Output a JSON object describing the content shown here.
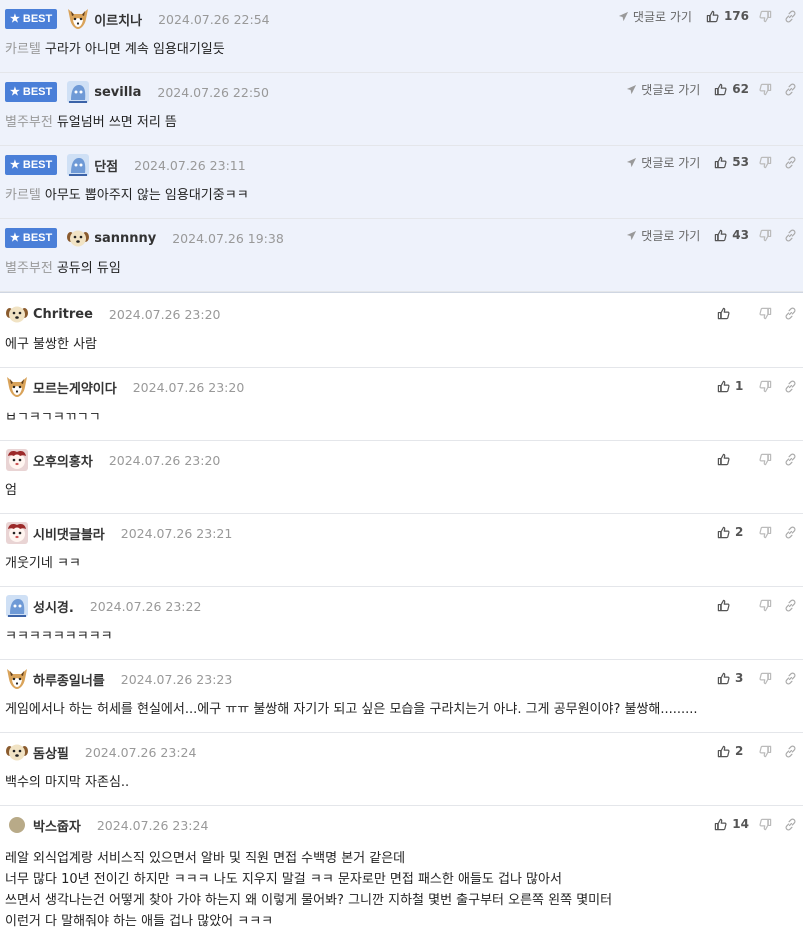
{
  "best_label": "BEST",
  "goto_label": "댓글로 가기",
  "best_comments": [
    {
      "nick": "이르치나",
      "date": "2024.07.26 22:54",
      "tag": "카르텔",
      "text": "구라가 아니면 계속 임용대기일듯",
      "likes": "176",
      "avatar": "fox"
    },
    {
      "nick": "sevilla",
      "date": "2024.07.26 22:50",
      "tag": "별주부전",
      "text": "듀얼넘버 쓰면 저리 뜸",
      "likes": "62",
      "avatar": "blue"
    },
    {
      "nick": "단점",
      "date": "2024.07.26 23:11",
      "tag": "카르텔",
      "text": "아무도 뽑아주지 않는 임용대기중ㅋㅋ",
      "likes": "53",
      "avatar": "blue"
    },
    {
      "nick": "sannnny",
      "date": "2024.07.26 19:38",
      "tag": "별주부전",
      "text": "공듀의 듀임",
      "likes": "43",
      "avatar": "dog"
    }
  ],
  "comments": [
    {
      "nick": "Chritree",
      "date": "2024.07.26 23:20",
      "text": "에구 불쌍한 사람",
      "likes": "",
      "avatar": "dog"
    },
    {
      "nick": "모르는게약이다",
      "date": "2024.07.26 23:20",
      "text": "ㅂㄱㅋㄱㅋㄲㄱㄱ",
      "likes": "1",
      "avatar": "fox"
    },
    {
      "nick": "오후의홍차",
      "date": "2024.07.26 23:20",
      "text": "엄",
      "likes": "",
      "avatar": "red"
    },
    {
      "nick": "시비댓글블라",
      "date": "2024.07.26 23:21",
      "text": "개웃기네 ㅋㅋ",
      "likes": "2",
      "avatar": "red"
    },
    {
      "nick": "성시경.",
      "date": "2024.07.26 23:22",
      "text": "ㅋㅋㅋㅋㅋㅋㅋㅋㅋ",
      "likes": "",
      "avatar": "blue"
    },
    {
      "nick": "하루종일너를",
      "date": "2024.07.26 23:23",
      "text": "게임에서나 하는 허세를 현실에서...에구 ㅠㅠ 불쌍해 자기가 되고 싶은 모습을 구라치는거 아냐. 그게 공무원이야? 불쌍해.........",
      "likes": "3",
      "avatar": "fox"
    },
    {
      "nick": "돔상필",
      "date": "2024.07.26 23:24",
      "text": "백수의 마지막 자존심..",
      "likes": "2",
      "avatar": "dog"
    }
  ],
  "last_comment": {
    "nick": "박스줍자",
    "date": "2024.07.26 23:24",
    "likes": "14",
    "avatar": "circle",
    "lines": [
      "레알 외식업계랑 서비스직 있으면서 알바 및 직원 면접 수백명 본거 같은데",
      "너무 많다 10년 전이긴 하지만 ㅋㅋㅋ 나도 지우지 말걸 ㅋㅋ 문자로만 면접 패스한 애들도 겁나 많아서",
      "쓰면서 생각나는건 어떻게 찾아 가야 하는지 왜 이렇게 물어봐? 그니깐 지하철 몇번 출구부터 오른쪽 왼쪽 몇미터",
      "이런거 다 말해줘야 하는 애들 겁나 많았어 ㅋㅋㅋ"
    ]
  },
  "colors": {
    "best_bg": "#eef2fb",
    "badge": "#4a7fd8",
    "date": "#999999",
    "tag": "#999999"
  }
}
